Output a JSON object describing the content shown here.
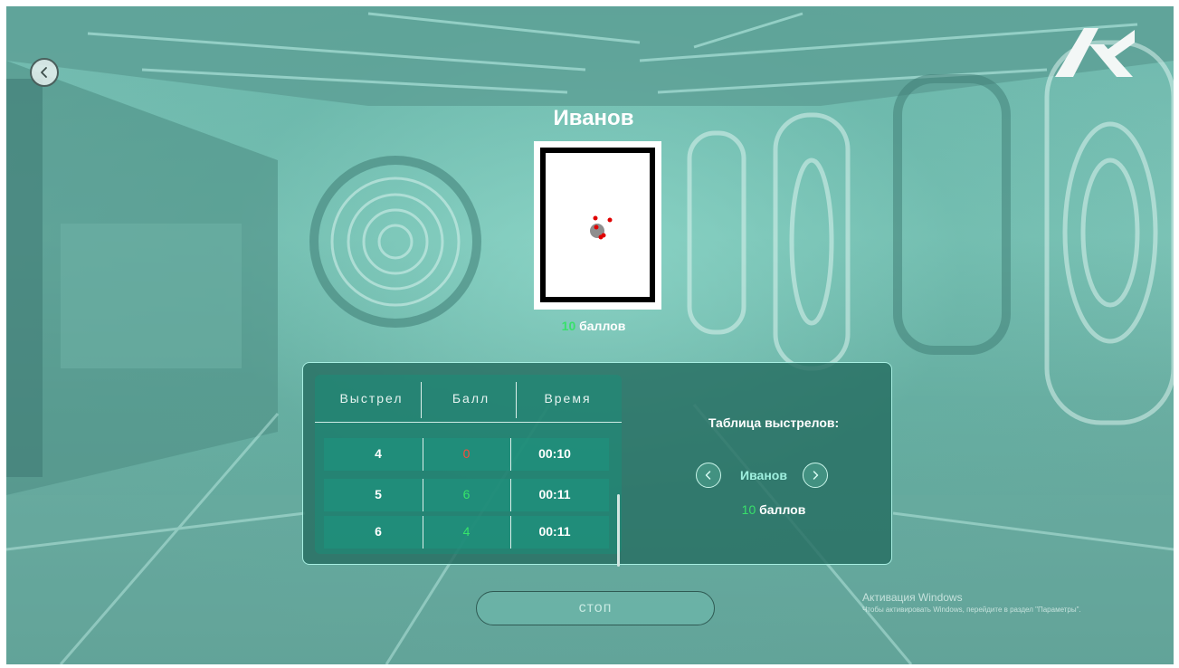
{
  "header": {
    "player_name": "Иванов"
  },
  "target": {
    "score_value": "10",
    "score_unit": "баллов"
  },
  "shots_table": {
    "columns": [
      "Выстрел",
      "Балл",
      "Время"
    ],
    "rows": [
      {
        "shot": "4",
        "score": "0",
        "time": "00:10",
        "score_color": "#ff4a3a"
      },
      {
        "shot": "5",
        "score": "6",
        "time": "00:11",
        "score_color": "#36e56a"
      },
      {
        "shot": "6",
        "score": "4",
        "time": "00:11",
        "score_color": "#36e56a"
      }
    ]
  },
  "side_panel": {
    "title": "Таблица выстрелов:",
    "player_name": "Иванов",
    "score_value": "10",
    "score_unit": "баллов"
  },
  "controls": {
    "stop_label": "стоп"
  },
  "windows_activation": {
    "title": "Активация Windows",
    "message": "Чтобы активировать Windows, перейдите в раздел \"Параметры\"."
  },
  "colors": {
    "accent_green": "#36e56a",
    "miss_red": "#ff4a3a",
    "panel_border": "#a8efe2"
  },
  "icons": {
    "back": "chevron-left-icon",
    "prev": "chevron-left-icon",
    "next": "chevron-right-icon",
    "logo": "brand-logo"
  }
}
